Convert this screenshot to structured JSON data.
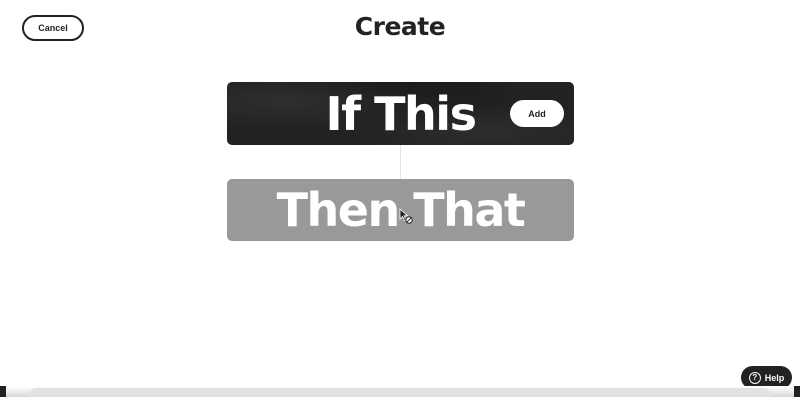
{
  "header": {
    "cancel_label": "Cancel",
    "title": "Create"
  },
  "trigger_card": {
    "title": "If This",
    "add_label": "Add"
  },
  "action_card": {
    "title": "Then That"
  },
  "help": {
    "label": "Help",
    "icon_glyph": "?"
  },
  "icons": {
    "help": "help-icon",
    "cursor": "not-allowed-cursor-icon"
  },
  "colors": {
    "primary_dark": "#222222",
    "disabled_card": "#999999",
    "background": "#ffffff"
  }
}
